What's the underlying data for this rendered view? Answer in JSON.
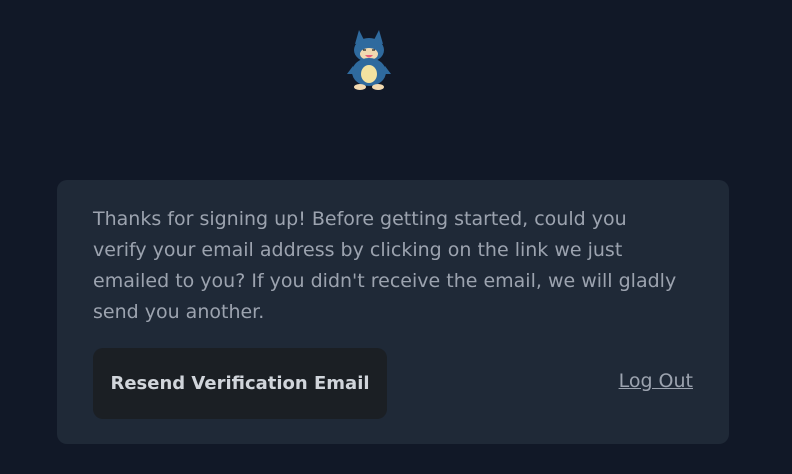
{
  "logo": {
    "icon": "munchlax-mascot-icon",
    "colors": {
      "body": "#2f6a9e",
      "belly": "#f3e2a0",
      "face": "#f2d9b0",
      "mouth": "#e8607a"
    }
  },
  "card": {
    "message": "Thanks for signing up! Before getting started, could you verify your email address by clicking on the link we just emailed to you? If you didn't receive the email, we will gladly send you another.",
    "resend_label": "Resend Verification Email",
    "logout_label": "Log Out"
  },
  "colors": {
    "background": "#111827",
    "card": "#1f2937",
    "text": "#9ca3af",
    "button_bg": "#1b1f24",
    "button_text": "#d1d5db"
  }
}
